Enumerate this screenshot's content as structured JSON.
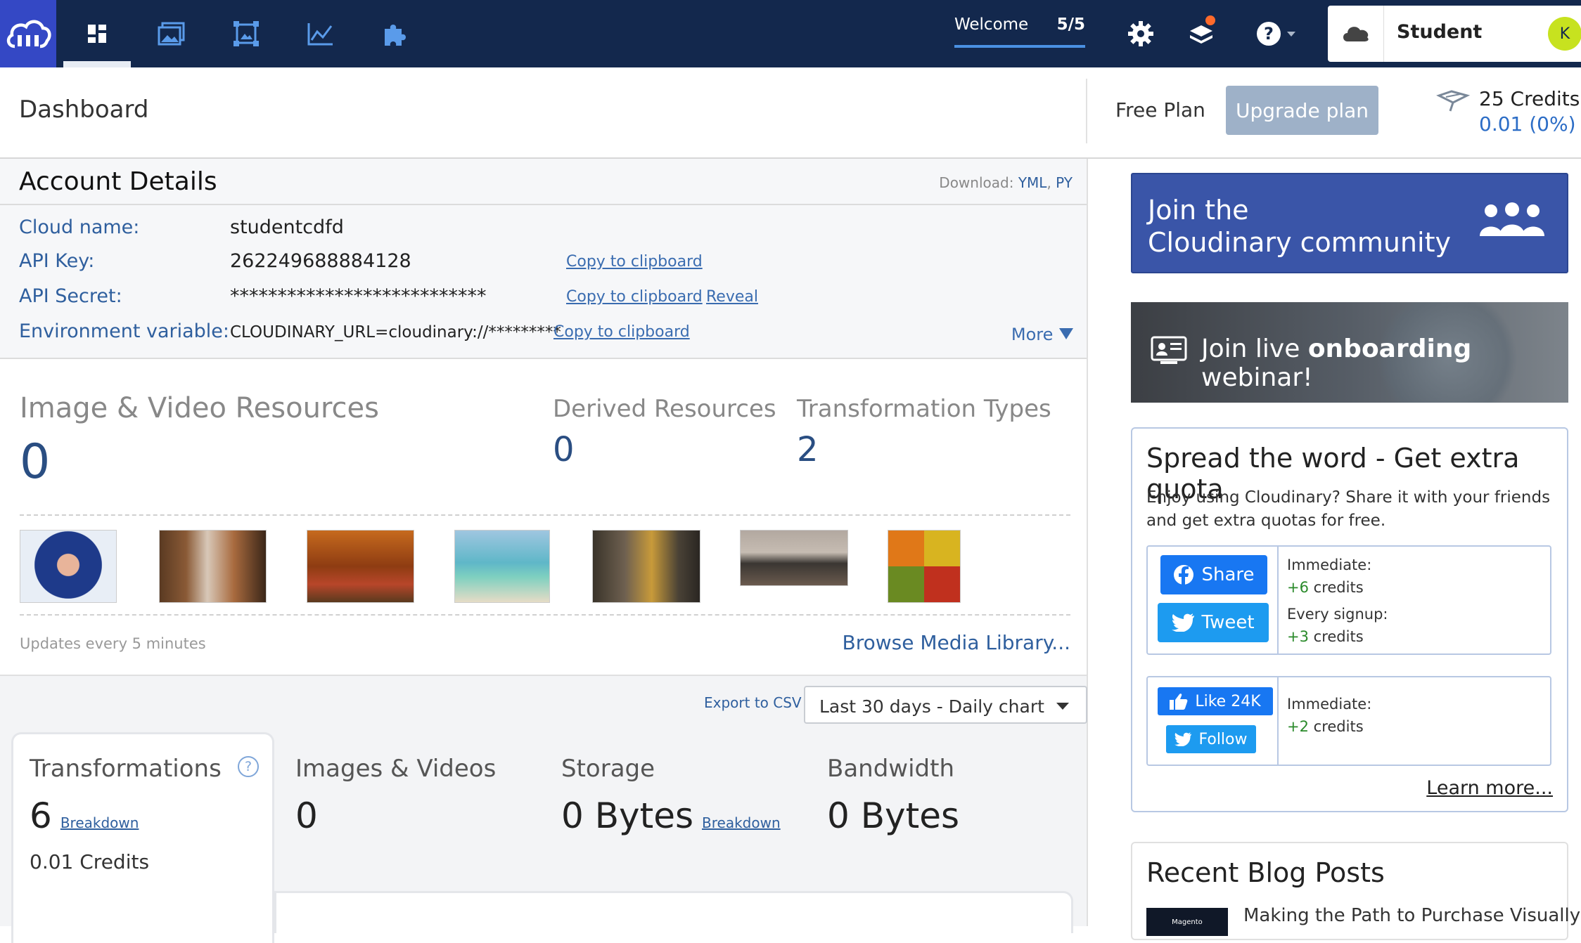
{
  "topbar": {
    "welcome_label": "Welcome",
    "welcome_count": "5/5",
    "account_name": "Student",
    "avatar_initial": "K",
    "nav_icons": [
      "dashboard-icon",
      "media-library-icon",
      "transformations-icon",
      "reports-icon",
      "addons-icon"
    ]
  },
  "header": {
    "title": "Dashboard",
    "plan": "Free Plan",
    "upgrade_label": "Upgrade plan",
    "credits": "25 Credits",
    "credits_used": "0.01 (0%)"
  },
  "account": {
    "title": "Account Details",
    "download_label": "Download:",
    "download_yml": "YML",
    "download_sep": ",",
    "download_py": "PY",
    "cloud_name_label": "Cloud name:",
    "cloud_name": "studentcdfd",
    "api_key_label": "API Key:",
    "api_key": "262249688884128",
    "api_secret_label": "API Secret:",
    "api_secret": "***************************",
    "env_label": "Environment variable:",
    "env_value": "CLOUDINARY_URL=cloudinary://*********",
    "copy_label": "Copy to clipboard",
    "reveal_label": "Reveal",
    "more_label": "More"
  },
  "resources": {
    "title": "Image & Video Resources",
    "count": "0",
    "derived_title": "Derived Resources",
    "derived_count": "0",
    "types_title": "Transformation Types",
    "types_count": "2",
    "updates_note": "Updates every 5 minutes",
    "browse_label": "Browse Media Library..."
  },
  "usage": {
    "export_label": "Export to CSV",
    "range_label": "Last 30 days - Daily chart",
    "transformations_title": "Transformations",
    "transformations_value": "6",
    "breakdown_label": "Breakdown",
    "transformations_credits": "0.01 Credits",
    "images_title": "Images & Videos",
    "images_value": "0",
    "storage_title": "Storage",
    "storage_value": "0 Bytes",
    "bandwidth_title": "Bandwidth",
    "bandwidth_value": "0 Bytes",
    "help_mark": "?"
  },
  "sidebar": {
    "join_line1": "Join the",
    "join_line2": "Cloudinary community",
    "webinar_pre": "Join live ",
    "webinar_bold": "onboarding",
    "webinar_post": " webinar!",
    "spread_title": "Spread the word - Get extra quota",
    "spread_text": "Enjoy using Cloudinary? Share it with your friends and get extra quotas for free.",
    "share_label": "Share",
    "tweet_label": "Tweet",
    "immediate_label": "Immediate:",
    "immediate_plus": "+6",
    "every_signup_label": "Every signup:",
    "signup_plus": "+3",
    "credits_word": "credits",
    "like_label": "Like 24K",
    "follow_label": "Follow",
    "immediate2_plus": "+2",
    "learn_more": "Learn more...",
    "blog_title": "Recent Blog Posts",
    "blog_post": "Making the Path to Purchase Visually",
    "blog_thumb_text": "Magento"
  },
  "colors": {
    "topbar": "#13284d",
    "brand": "#3448c5",
    "link": "#2f5f9e",
    "upgrade": "#9eb1c8"
  }
}
